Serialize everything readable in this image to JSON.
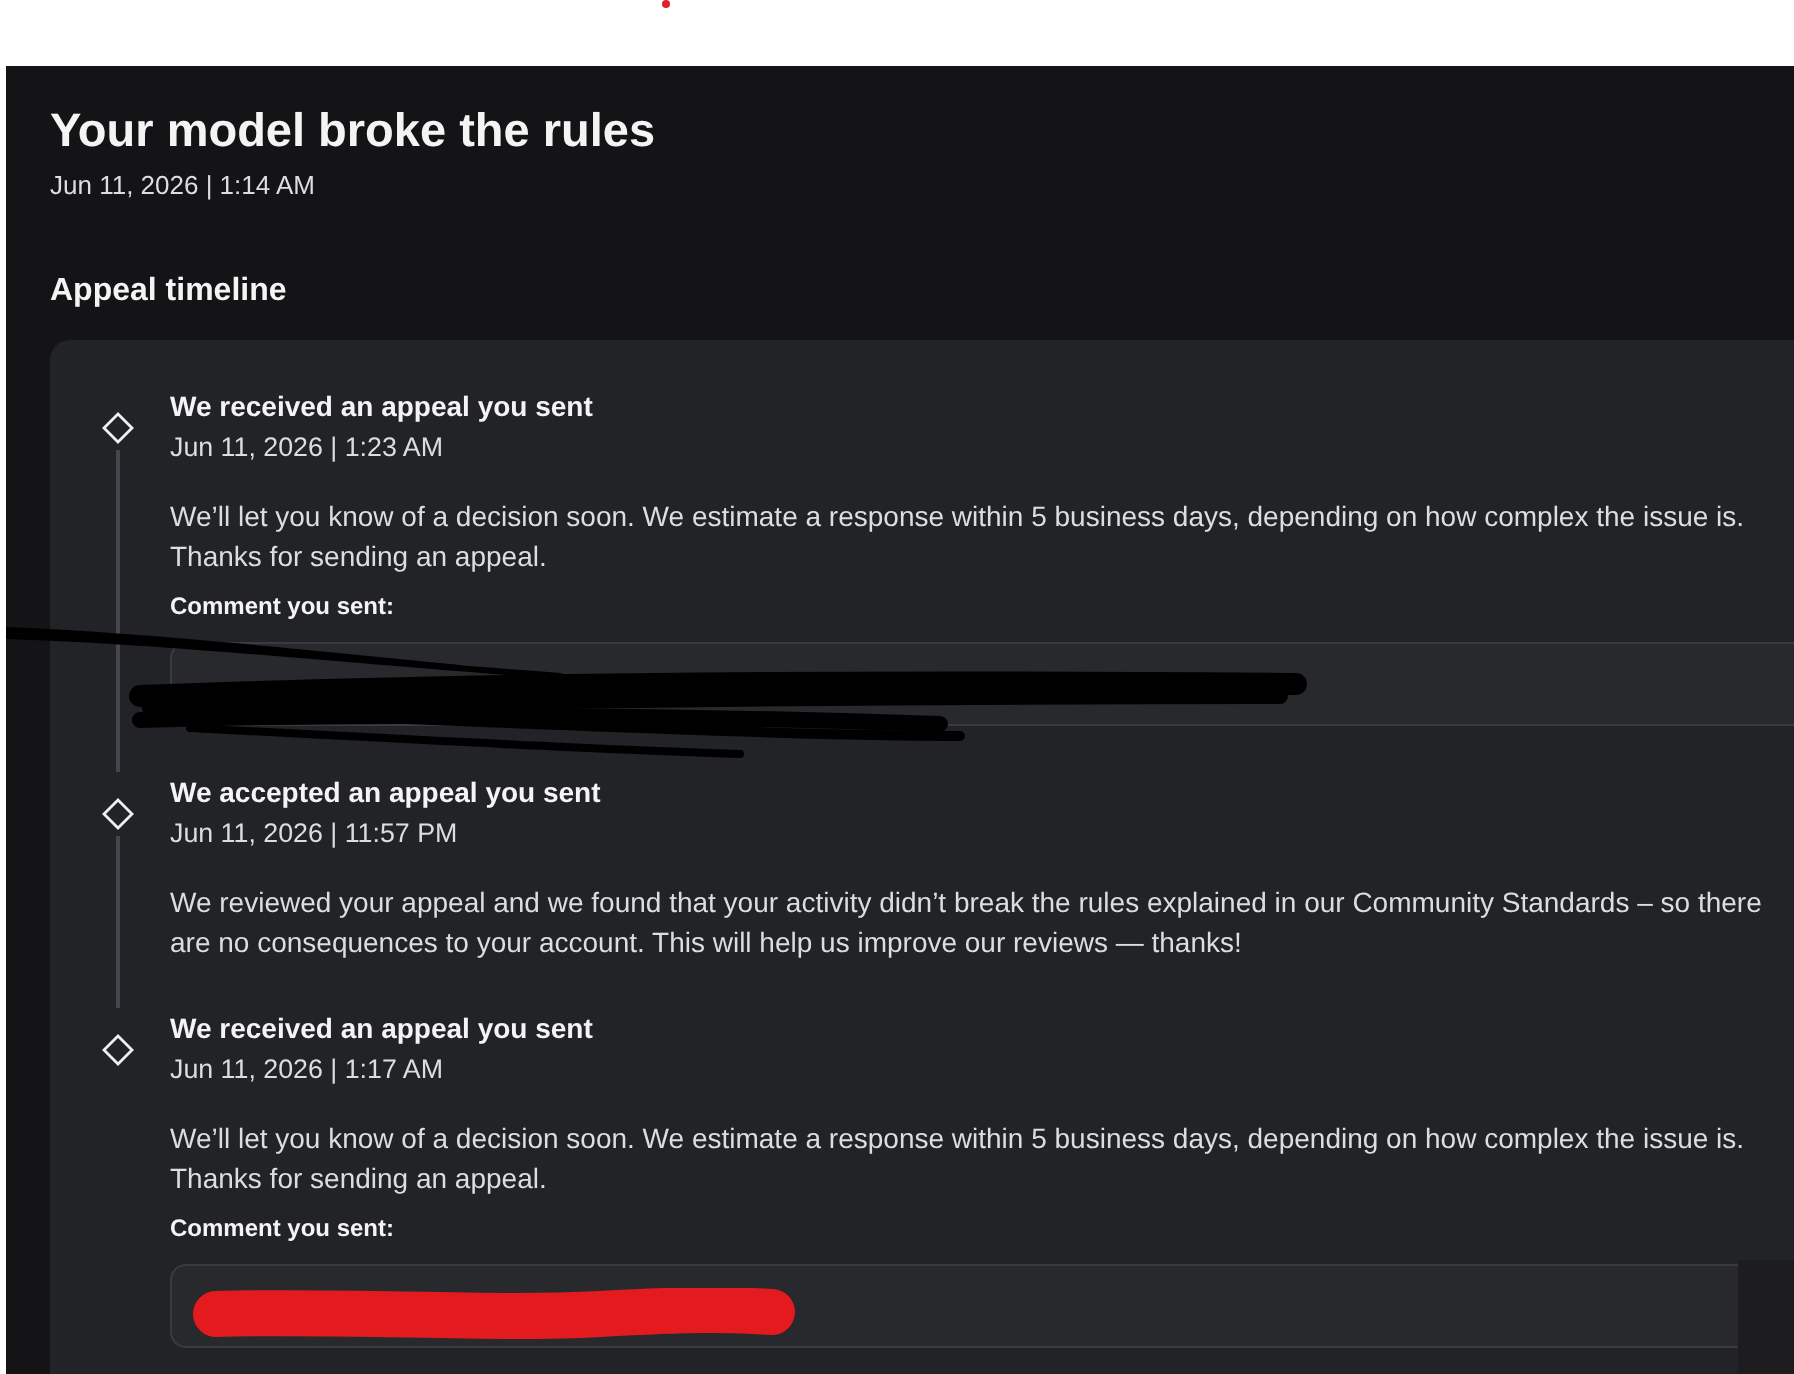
{
  "header": {
    "title": "Your model broke the rules",
    "date": "Jun 11, 2026 | 1:14 AM"
  },
  "timeline": {
    "heading": "Appeal timeline",
    "events": [
      {
        "title": "We received an appeal you sent",
        "date": "Jun 11, 2026 | 1:23 AM",
        "body": "We’ll let you know of a decision soon. We estimate a response within 5 business days, depending on how complex the issue is. Thanks for sending an appeal.",
        "comment": {
          "label": "Comment you sent:",
          "kind": "scribble"
        }
      },
      {
        "title": "We accepted an appeal you sent",
        "date": "Jun 11, 2026 | 11:57 PM",
        "body": "We reviewed your appeal and we found that your activity didn’t break the rules explained in our Community Standards – so there are no consequences to your account. This will help us improve our reviews — thanks!"
      },
      {
        "title": "We received an appeal you sent",
        "date": "Jun 11, 2026 | 1:17 AM",
        "body": "We’ll let you know of a decision soon. We estimate a response within 5 business days, depending on how complex the issue is. Thanks for sending an appeal.",
        "comment": {
          "label": "Comment you sent:",
          "kind": "marker"
        }
      }
    ]
  }
}
